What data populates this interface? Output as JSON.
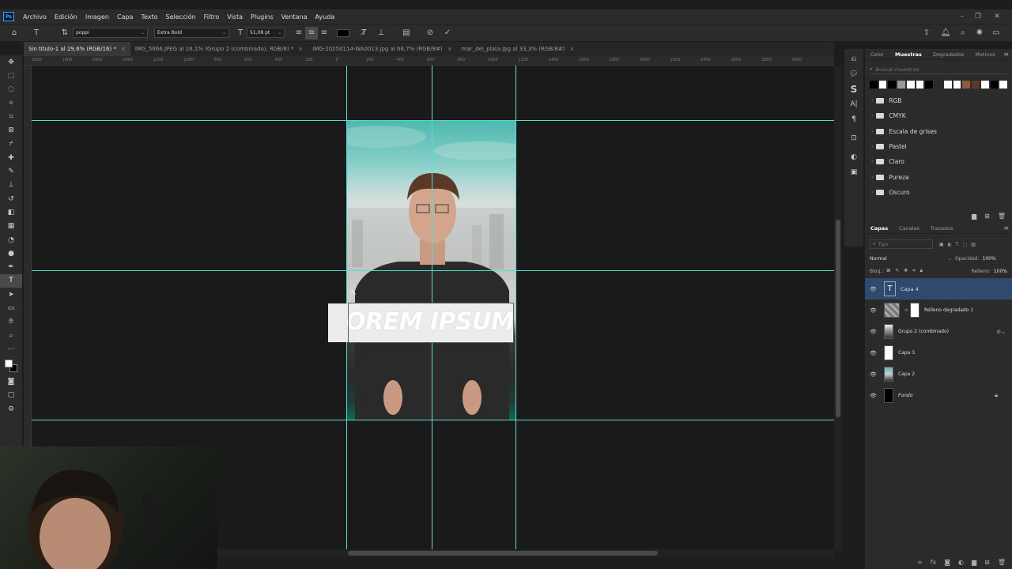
{
  "app": {
    "logo": "Ps"
  },
  "menu": [
    "Archivo",
    "Edición",
    "Imagen",
    "Capa",
    "Texto",
    "Selección",
    "Filtro",
    "Vista",
    "Plugins",
    "Ventana",
    "Ayuda"
  ],
  "options": {
    "font_family": "poppi",
    "font_style": "Extra Bold",
    "font_size": "51,08 pt"
  },
  "tabs": [
    {
      "label": "Sin título-1 al 29,6% (RGB/16) *",
      "active": true
    },
    {
      "label": "IMG_5866.JPEG al 16,1% (Grupo 2 (combinado), RGB/8) *",
      "active": false
    },
    {
      "label": "IMG-20250114-WA0013.jpg al 66,7% (RGB/8#)",
      "active": false
    },
    {
      "label": "mar_del_plata.jpg al 33,3% (RGB/8#)",
      "active": false
    }
  ],
  "tab_close": "×",
  "ruler_ticks": [
    "2000",
    "1800",
    "1600",
    "1400",
    "1200",
    "1000",
    "800",
    "600",
    "400",
    "200",
    "0",
    "200",
    "400",
    "600",
    "800",
    "1000",
    "1200",
    "1400",
    "1600",
    "1800",
    "2000",
    "2200",
    "2400",
    "2600",
    "2800",
    "3000"
  ],
  "canvas": {
    "text_content": "OREM IPSUM"
  },
  "swatches_panel": {
    "tabs": [
      "Color",
      "Muestras",
      "Degradados",
      "Motivos"
    ],
    "active_tab": "Muestras",
    "search_placeholder": "Buscar muestras",
    "swatch_colors": [
      "#000000",
      "#ffffff",
      "#000000",
      "#9a9a9a",
      "#ffffff",
      "#ffffff",
      "#000000",
      "#2a2a2a",
      "#ffffff",
      "#ffffff",
      "#8a5a3a",
      "#5a3a2a",
      "#ffffff",
      "#000000",
      "#ffffff"
    ],
    "folders": [
      "RGB",
      "CMYK",
      "Escala de grises",
      "Pastel",
      "Claro",
      "Pureza",
      "Oscuro"
    ]
  },
  "layers_panel": {
    "tabs": [
      "Capas",
      "Canales",
      "Trazados"
    ],
    "active_tab": "Capas",
    "search_placeholder": "Tipo",
    "blend_mode": "Normal",
    "opacity_label": "Opacidad:",
    "opacity_value": "100%",
    "lock_label": "Bloq.:",
    "fill_label": "Relleno:",
    "fill_value": "100%",
    "layers": [
      {
        "name": "Capa 4",
        "type": "text",
        "selected": true
      },
      {
        "name": "Relleno degradado 1",
        "type": "gradient",
        "selected": false
      },
      {
        "name": "Grupo 2 (combinado)",
        "type": "photo",
        "selected": false
      },
      {
        "name": "Capa 3",
        "type": "white",
        "selected": false
      },
      {
        "name": "Capa 2",
        "type": "photo",
        "selected": false
      },
      {
        "name": "Fondo",
        "type": "black",
        "selected": false,
        "locked": true
      }
    ]
  }
}
